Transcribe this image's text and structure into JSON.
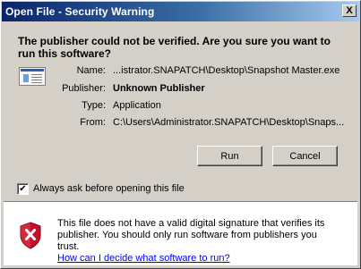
{
  "window": {
    "title": "Open File - Security Warning",
    "close_label": "X"
  },
  "dialog": {
    "headline": "The publisher could not be verified.  Are you sure you want to run this software?",
    "icon": "application-window-icon",
    "fields": [
      {
        "label": "Name:",
        "value": "...istrator.SNAPATCH\\Desktop\\Snapshot Master.exe",
        "bold": false
      },
      {
        "label": "Publisher:",
        "value": "Unknown Publisher",
        "bold": true
      },
      {
        "label": "Type:",
        "value": "Application",
        "bold": false
      },
      {
        "label": "From:",
        "value": "C:\\Users\\Administrator.SNAPATCH\\Desktop\\Snaps...",
        "bold": false
      }
    ],
    "buttons": {
      "run": "Run",
      "cancel": "Cancel"
    },
    "checkbox": {
      "label": "Always ask before opening this file",
      "checked": true,
      "mark": "✔"
    }
  },
  "warning": {
    "icon": "shield-error-icon",
    "text": "This file does not have a valid digital signature that verifies its publisher.  You should only run software from publishers you trust.",
    "link": "How can I decide what software to run?"
  },
  "colors": {
    "dialog_bg": "#d4d0c8",
    "title_start": "#0a246a",
    "title_end": "#a6caf0",
    "link": "#0000ff",
    "shield_red": "#c8102e"
  }
}
